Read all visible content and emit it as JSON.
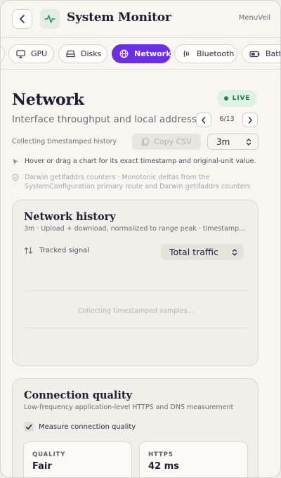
{
  "header": {
    "title": "System Monitor",
    "brand": "MenuVeil"
  },
  "tabs": [
    {
      "label": "GPU",
      "icon": "monitor-icon",
      "active": false
    },
    {
      "label": "Disks",
      "icon": "drive-icon",
      "active": false
    },
    {
      "label": "Network",
      "icon": "globe-icon",
      "active": true
    },
    {
      "label": "Bluetooth",
      "icon": "bluetooth-icon",
      "active": false
    },
    {
      "label": "Batt",
      "icon": "battery-icon",
      "active": false
    }
  ],
  "page": {
    "title": "Network",
    "live_label": "LIVE",
    "subtitle": "Interface throughput and local addresses",
    "pager": "6/13",
    "status": "Collecting timestamped history",
    "copy_label": "Copy CSV",
    "range_value": "3m",
    "hint": "Hover or drag a chart for its exact timestamp and original-unit value.",
    "source_line1": "Darwin getifaddrs counters · Monotonic deltas from the",
    "source_line2": "SystemConfiguration primary route and Darwin getifaddrs counters"
  },
  "history": {
    "title": "Network history",
    "subtitle": "3m · Upload + download, normalized to range peak · timestamp…",
    "signal_label": "Tracked signal",
    "signal_value": "Total traffic",
    "empty_text": "Collecting timestamped samples…"
  },
  "quality": {
    "title": "Connection quality",
    "subtitle": "Low-frequency application-level HTTPS and DNS measurement",
    "checkbox_label": "Measure connection quality",
    "checked": true,
    "metrics": [
      {
        "label": "QUALITY",
        "value": "Fair"
      },
      {
        "label": "HTTPS",
        "value": "42 ms"
      }
    ]
  },
  "colors": {
    "accent": "#6a2fe5",
    "live": "#1f8a4a",
    "background": "#f8f6f1"
  }
}
